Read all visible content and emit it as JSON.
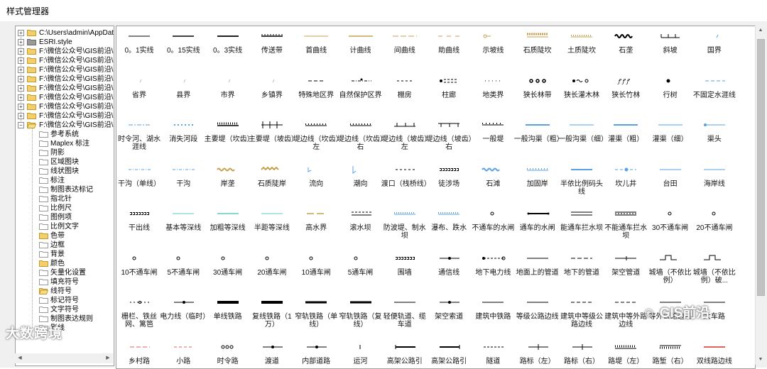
{
  "window": {
    "title": "样式管理器"
  },
  "tree": {
    "roots": [
      {
        "label": "C:\\Users\\admin\\AppData\\",
        "expander": "+"
      },
      {
        "label": "ESRI.style",
        "expander": "+"
      },
      {
        "label": "F:\\微信公众号\\GIS前沿\\",
        "expander": "+"
      },
      {
        "label": "F:\\微信公众号\\GIS前沿\\",
        "expander": "+"
      },
      {
        "label": "F:\\微信公众号\\GIS前沿\\",
        "expander": "+"
      },
      {
        "label": "F:\\微信公众号\\GIS前沿\\",
        "expander": "+"
      },
      {
        "label": "F:\\微信公众号\\GIS前沿\\",
        "expander": "+"
      },
      {
        "label": "F:\\微信公众号\\GIS前沿\\",
        "expander": "+"
      },
      {
        "label": "F:\\微信公众号\\GIS前沿\\",
        "expander": "+"
      },
      {
        "label": "F:\\微信公众号\\GIS前沿\\",
        "expander": "+"
      },
      {
        "label": "F:\\微信公众号\\GIS前沿\\",
        "expander": "−"
      }
    ],
    "children": [
      "参考系统",
      "Maplex 标注",
      "阴影",
      "区域图块",
      "线状图块",
      "标注",
      "制图表达标记",
      "指北针",
      "比例尺",
      "图例项",
      "比例文字",
      "色带",
      "边框",
      "背景",
      "颜色",
      "矢量化设置",
      "填充符号",
      "线符号",
      "标记符号",
      "文字符号",
      "制图表达规则",
      "影线"
    ],
    "open_child": "线符号"
  },
  "symbols": [
    [
      "0。1实线",
      "0。15实线",
      "0。3实线",
      "传送带",
      "首曲线",
      "计曲线",
      "间曲线",
      "助曲线",
      "示坡线",
      "石质陡坎",
      "土质陡坎",
      "石垄",
      "斜坡",
      "国界"
    ],
    [
      "省界",
      "县界",
      "市界",
      "乡镇界",
      "特殊地区界",
      "自然保护区界",
      "棚房",
      "柱廊",
      "地类界",
      "狭长林带",
      "狭长灌木林",
      "狭长竹林",
      "行树",
      "不固定水涯线"
    ],
    [
      "时令河、湖水涯线",
      "消失河段",
      "主要堤（坎齿）",
      "主要堤（坡齿）",
      "堤边线（坎齿）左",
      "堤边线（坎齿）右",
      "堤边线（坡齿）左",
      "堤边线（坡齿）右",
      "一般堤",
      "一般沟渠（粗）",
      "一般沟渠（细）",
      "灌渠（粗）",
      "灌渠（细）",
      "渠头"
    ],
    [
      "干沟（单线）",
      "干沟",
      "岸垄",
      "石质陡岸",
      "流向",
      "潮向",
      "渡口（栈桥线）",
      "徒涉场",
      "石滩",
      "加固岸",
      "半依比例码头线",
      "坎儿井",
      "台田",
      "海岸线"
    ],
    [
      "干出线",
      "基本等深线",
      "加粗等深线",
      "半距等深线",
      "高水界",
      "滚水坝",
      "防波堤、制水坝",
      "瀑布、跌水",
      "不通车的水闸",
      "通车的水闸",
      "能通车拦水坝",
      "不能通车拦水坝",
      "30不通车闸",
      "20不通车闸"
    ],
    [
      "10不通车闸",
      "5不通车闸",
      "30通车闸",
      "20通车闸",
      "10通车闸",
      "5通车闸",
      "围墙",
      "通信线",
      "地下电力线",
      "地面上的管道",
      "地下的管道",
      "架空管道",
      "城墙（不依比例）",
      "城墙（不依比例）破..."
    ],
    [
      "栅栏、铁丝网、篱笆",
      "电力线（临时）",
      "单线铁路",
      "复线铁路（1万）",
      "窄轨铁路（单线）",
      "窄轨铁路（复线）",
      "轻便轨道、缆车道",
      "架空索道",
      "建筑中铁路",
      "等级公路边线",
      "建筑中等级公路边线",
      "建筑中等外路边线",
      "等外公路边线",
      "大车路"
    ],
    [
      "乡村路",
      "小路",
      "时令路",
      "渡道",
      "内部道路",
      "运河",
      "高架公路引",
      "高架公路引",
      "隧道",
      "路标（左）",
      "路标（右）",
      "路堤（左）",
      "路堑（右）",
      "双线路边线"
    ]
  ],
  "colors": {
    "black": "#000000",
    "brown": "#c8a050",
    "blue": "#5aa0e6",
    "cyan": "#60c8c0",
    "red": "#e06060",
    "panel": "#f0f0f0"
  },
  "watermarks": {
    "left": "大数跨境",
    "right": "GIS前沿"
  }
}
